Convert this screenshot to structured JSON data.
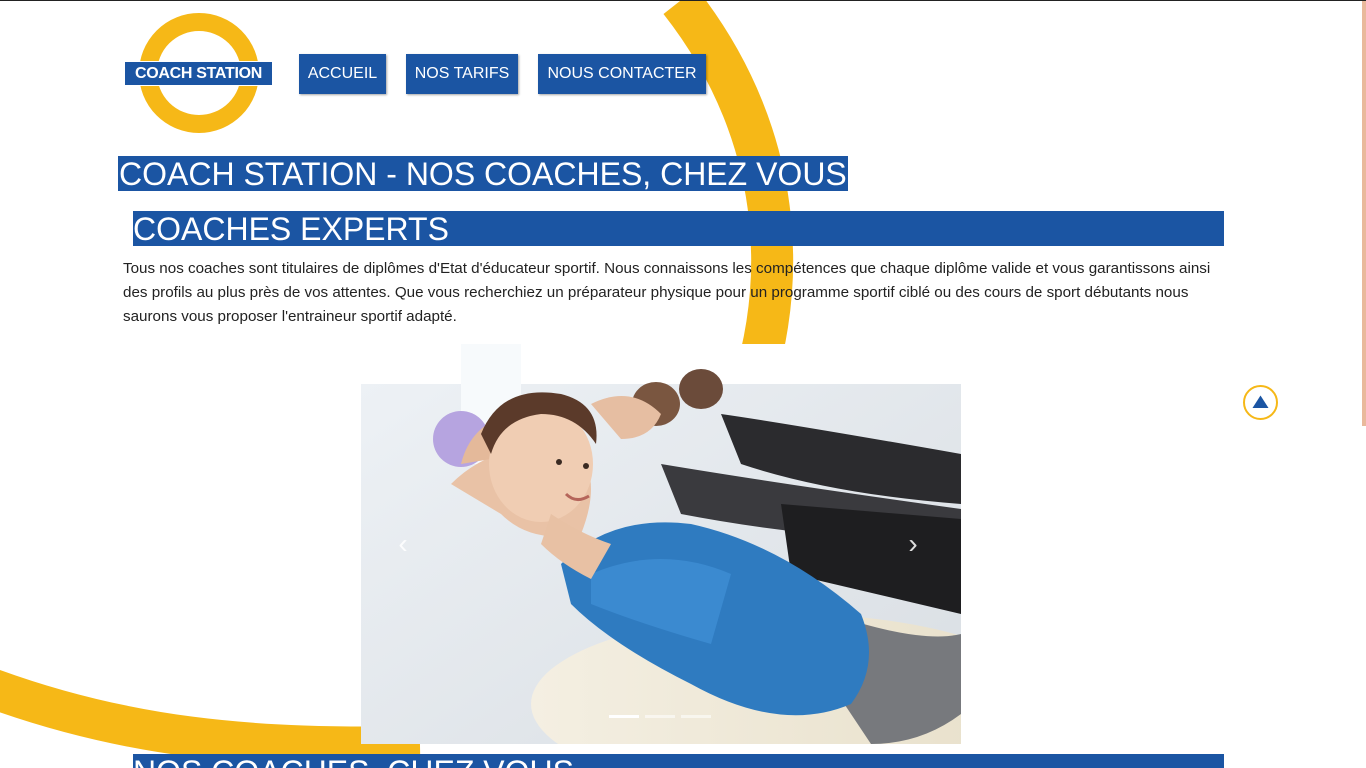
{
  "logo": {
    "text": "COACH STATION"
  },
  "nav": {
    "items": [
      {
        "label": "ACCUEIL"
      },
      {
        "label": "NOS TARIFS"
      },
      {
        "label": "NOUS CONTACTER"
      }
    ]
  },
  "main": {
    "title": "COACH STATION - NOS COACHES, CHEZ VOUS",
    "section1": {
      "heading": "COACHES EXPERTS",
      "text": "Tous nos coaches sont titulaires de diplômes d'Etat d'éducateur sportif. Nous connaissons les compétences que chaque diplôme valide et vous garantissons ainsi des profils au plus près de vos attentes. Que vous recherchiez un préparateur physique pour un programme sportif ciblé ou des cours de sport débutants nous saurons vous proposer l'entraineur sportif adapté."
    },
    "carousel": {
      "prev_icon": "chevron-left-icon",
      "next_icon": "chevron-right-icon",
      "slide_count": 3,
      "active_slide": 1
    },
    "section2": {
      "heading": "NOS COACHES, CHEZ VOUS"
    }
  },
  "back_to_top": {
    "icon": "arrow-up-icon"
  },
  "colors": {
    "brand_blue": "#1b55a3",
    "brand_yellow": "#f6b817",
    "text": "#222222"
  }
}
